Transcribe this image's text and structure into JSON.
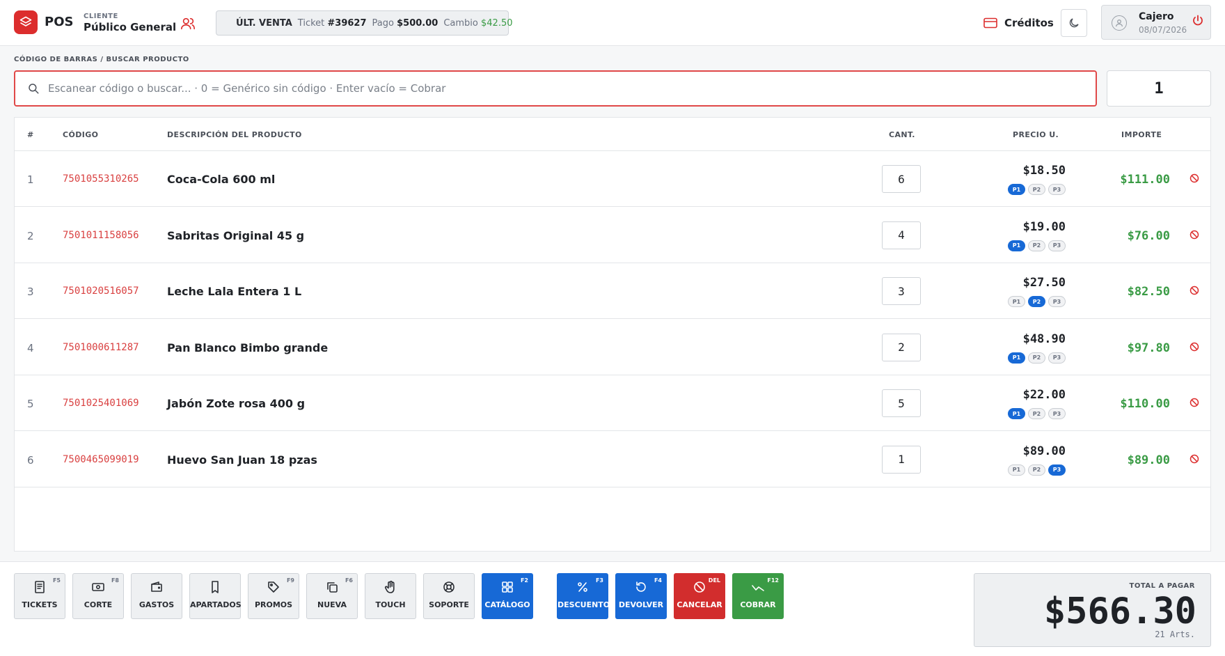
{
  "header": {
    "app_name": "POS",
    "client_label": "CLIENTE",
    "client_name": "Público General",
    "last_sale": {
      "label": "ÚLT. VENTA",
      "ticket_label": "Ticket",
      "ticket_number": "#39627",
      "payment_label": "Pago",
      "payment_value": "$500.00",
      "change_label": "Cambio",
      "change_value": "$42.50"
    },
    "credits_label": "Créditos",
    "cashier_name": "Cajero",
    "cashier_date": "08/07/2026"
  },
  "search": {
    "label": "CÓDIGO DE BARRAS / BUSCAR PRODUCTO",
    "placeholder": "Escanear código o buscar... · 0 = Genérico sin código · Enter vacío = Cobrar",
    "quantity": "1"
  },
  "table": {
    "columns": {
      "index": "#",
      "code": "CÓDIGO",
      "description": "DESCRIPCIÓN DEL PRODUCTO",
      "qty": "CANT.",
      "unit_price": "PRECIO U.",
      "amount": "IMPORTE"
    },
    "tier_labels": [
      "P1",
      "P2",
      "P3"
    ],
    "rows": [
      {
        "index": "1",
        "code": "7501055310265",
        "description": "Coca-Cola 600 ml",
        "qty": "6",
        "price": "$18.50",
        "active_tier": 1,
        "amount": "$111.00"
      },
      {
        "index": "2",
        "code": "7501011158056",
        "description": "Sabritas Original 45 g",
        "qty": "4",
        "price": "$19.00",
        "active_tier": 1,
        "amount": "$76.00"
      },
      {
        "index": "3",
        "code": "7501020516057",
        "description": "Leche Lala Entera 1 L",
        "qty": "3",
        "price": "$27.50",
        "active_tier": 2,
        "amount": "$82.50"
      },
      {
        "index": "4",
        "code": "7501000611287",
        "description": "Pan Blanco Bimbo grande",
        "qty": "2",
        "price": "$48.90",
        "active_tier": 1,
        "amount": "$97.80"
      },
      {
        "index": "5",
        "code": "7501025401069",
        "description": "Jabón Zote rosa 400 g",
        "qty": "5",
        "price": "$22.00",
        "active_tier": 1,
        "amount": "$110.00"
      },
      {
        "index": "6",
        "code": "7500465099019",
        "description": "Huevo San Juan 18 pzas",
        "qty": "1",
        "price": "$89.00",
        "active_tier": 3,
        "amount": "$89.00"
      }
    ]
  },
  "footer": {
    "buttons": [
      {
        "label": "TICKETS",
        "key": "F5",
        "icon": "receipt-icon",
        "style": "gray"
      },
      {
        "label": "CORTE",
        "key": "F8",
        "icon": "cash-icon",
        "style": "gray"
      },
      {
        "label": "GASTOS",
        "key": "",
        "icon": "wallet-icon",
        "style": "gray"
      },
      {
        "label": "APARTADOS",
        "key": "",
        "icon": "bookmark-icon",
        "style": "gray"
      },
      {
        "label": "PROMOS",
        "key": "F9",
        "icon": "tag-icon",
        "style": "gray"
      },
      {
        "label": "NUEVA",
        "key": "F6",
        "icon": "copy-icon",
        "style": "gray"
      },
      {
        "label": "TOUCH",
        "key": "",
        "icon": "hand-icon",
        "style": "gray"
      },
      {
        "label": "SOPORTE",
        "key": "",
        "icon": "lifebuoy-icon",
        "style": "gray"
      },
      {
        "label": "CATÁLOGO",
        "key": "F2",
        "icon": "grid-icon",
        "style": "blue"
      },
      {
        "label": "DESCUENTO",
        "key": "F3",
        "icon": "percent-icon",
        "style": "blue"
      },
      {
        "label": "DEVOLVER",
        "key": "F4",
        "icon": "return-icon",
        "style": "blue"
      },
      {
        "label": "CANCELAR",
        "key": "DEL",
        "icon": "ban-icon",
        "style": "red"
      },
      {
        "label": "COBRAR",
        "key": "F12",
        "icon": "trend-icon",
        "style": "green"
      }
    ],
    "total_label": "TOTAL A PAGAR",
    "total_value": "$566.30",
    "articles": "21 Arts."
  },
  "colors": {
    "brand_red": "#dc2d2d",
    "code_red": "#d94040",
    "amount_green": "#3a9b45",
    "tier_blue": "#1769d6",
    "cancel_red": "#d22d2d",
    "charge_green": "#3a9b45"
  }
}
